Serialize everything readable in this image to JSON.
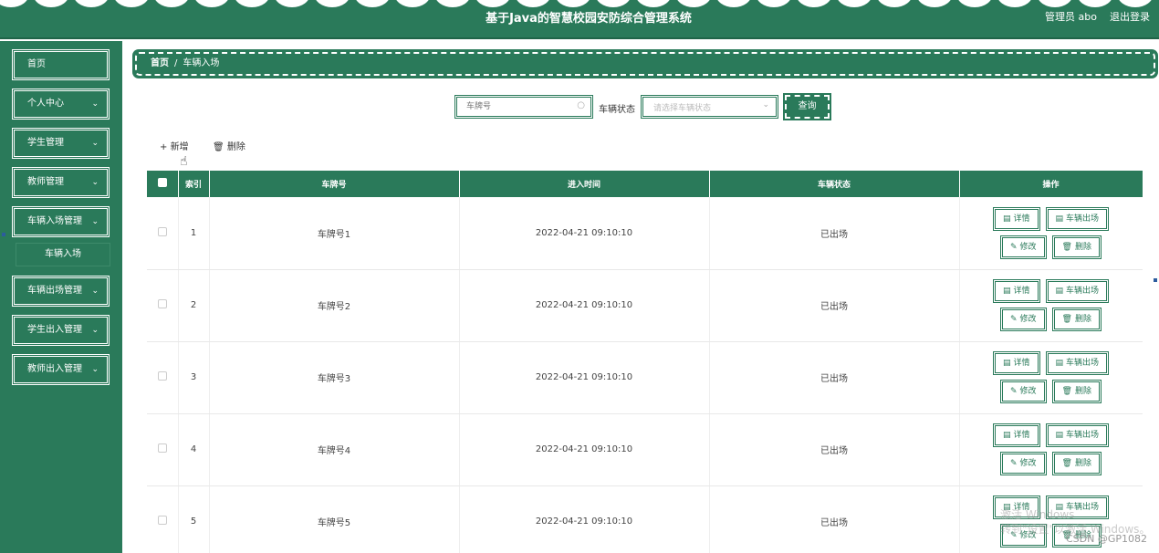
{
  "header": {
    "title": "基于Java的智慧校园安防综合管理系统",
    "user": "管理员 abo",
    "logout": "退出登录"
  },
  "sidebar": {
    "items": [
      {
        "label": "首页",
        "chev": ""
      },
      {
        "label": "个人中心",
        "chev": "⌄"
      },
      {
        "label": "学生管理",
        "chev": "⌄"
      },
      {
        "label": "教师管理",
        "chev": "⌄"
      },
      {
        "label": "车辆入场管理",
        "chev": "⌄"
      },
      {
        "label": "车辆出场管理",
        "chev": "⌄"
      },
      {
        "label": "学生出入管理",
        "chev": "⌄"
      },
      {
        "label": "教师出入管理",
        "chev": "⌄"
      }
    ],
    "sub_item": "车辆入场"
  },
  "breadcrumb": {
    "home": "首页",
    "sep": "/",
    "current": "车辆入场"
  },
  "search": {
    "plate_placeholder": "车牌号",
    "status_label": "车辆状态",
    "status_placeholder": "请选择车辆状态",
    "query": "查询"
  },
  "actions": {
    "add": "新增",
    "delete": "删除"
  },
  "table": {
    "headers": [
      "索引",
      "车牌号",
      "进入时间",
      "车辆状态",
      "操作"
    ],
    "rows": [
      {
        "index": "1",
        "plate": "车牌号1",
        "time": "2022-04-21 09:10:10",
        "status": "已出场"
      },
      {
        "index": "2",
        "plate": "车牌号2",
        "time": "2022-04-21 09:10:10",
        "status": "已出场"
      },
      {
        "index": "3",
        "plate": "车牌号3",
        "time": "2022-04-21 09:10:10",
        "status": "已出场"
      },
      {
        "index": "4",
        "plate": "车牌号4",
        "time": "2022-04-21 09:10:10",
        "status": "已出场"
      },
      {
        "index": "5",
        "plate": "车牌号5",
        "time": "2022-04-21 09:10:10",
        "status": "已出场"
      }
    ],
    "ops": {
      "detail": "详情",
      "exit": "车辆出场",
      "edit": "修改",
      "remove": "删除"
    }
  },
  "watermark": "CSDN @GP1082",
  "windows_watermark": [
    "激活 Windows",
    "转到\"设置\"以激活 Windows。"
  ],
  "colors": {
    "primary": "#2a7a5a"
  },
  "icons": {
    "search": "search-icon",
    "chevron": "chevron-down-icon",
    "plus": "plus-icon",
    "trash": "trash-icon",
    "doc": "document-icon",
    "pencil": "pencil-icon",
    "pointer": "hand-pointer-icon"
  }
}
